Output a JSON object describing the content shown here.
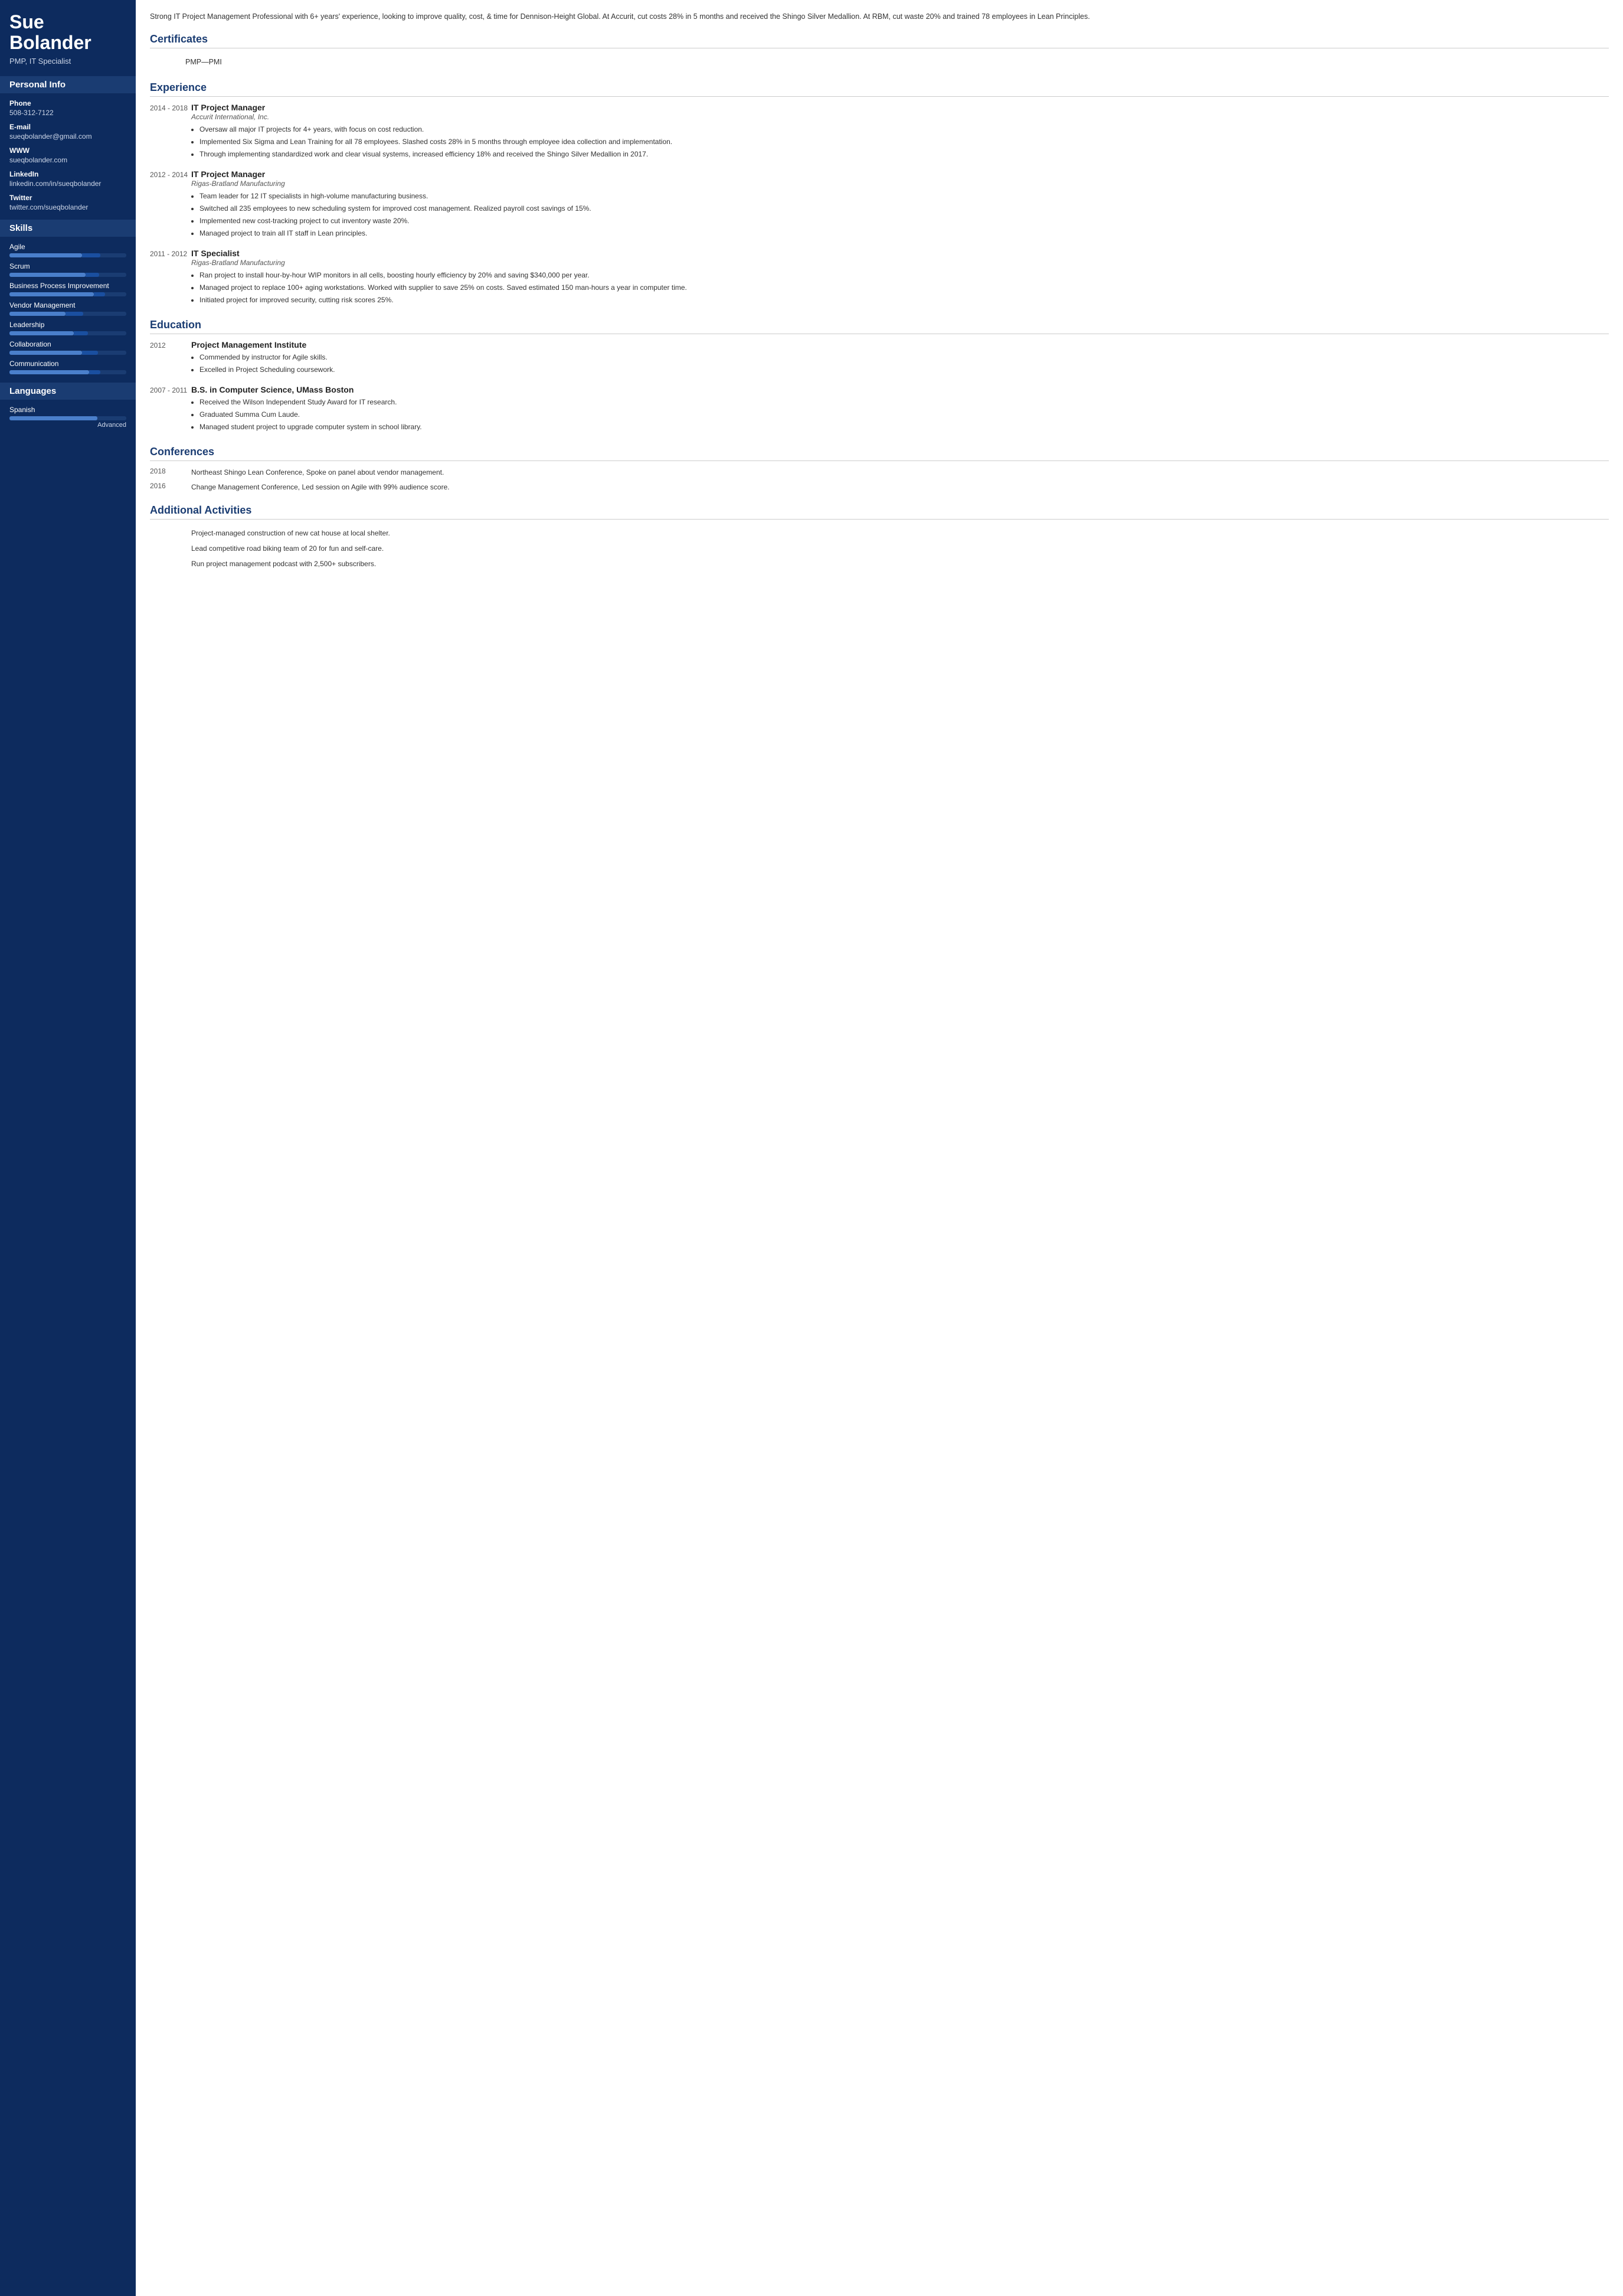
{
  "sidebar": {
    "name": "Sue Bolander",
    "title": "PMP, IT Specialist",
    "personal_info_label": "Personal Info",
    "phone_label": "Phone",
    "phone": "508-312-7122",
    "email_label": "E-mail",
    "email": "sueqbolander@gmail.com",
    "www_label": "WWW",
    "www": "sueqbolander.com",
    "linkedin_label": "LinkedIn",
    "linkedin": "linkedin.com/in/sueqbolander",
    "twitter_label": "Twitter",
    "twitter": "twitter.com/sueqbolander",
    "skills_label": "Skills",
    "skills": [
      {
        "name": "Agile",
        "fill": 62,
        "accent_start": 62,
        "accent_width": 16
      },
      {
        "name": "Scrum",
        "fill": 65,
        "accent_start": 65,
        "accent_width": 12
      },
      {
        "name": "Business Process Improvement",
        "fill": 72,
        "accent_start": 72,
        "accent_width": 10
      },
      {
        "name": "Vendor Management",
        "fill": 48,
        "accent_start": 48,
        "accent_width": 15
      },
      {
        "name": "Leadership",
        "fill": 55,
        "accent_start": 55,
        "accent_width": 12
      },
      {
        "name": "Collaboration",
        "fill": 62,
        "accent_start": 62,
        "accent_width": 14
      },
      {
        "name": "Communication",
        "fill": 68,
        "accent_start": 68,
        "accent_width": 10
      }
    ],
    "languages_label": "Languages",
    "languages": [
      {
        "name": "Spanish",
        "fill": 75,
        "accent_start": 75,
        "accent_width": 0,
        "level": "Advanced"
      }
    ]
  },
  "main": {
    "summary": "Strong IT Project Management Professional with 6+ years' experience, looking to improve quality, cost, & time for Dennison-Height Global. At Accurit, cut costs 28% in 5 months and received the Shingo Silver Medallion. At RBM, cut waste 20% and trained 78 employees in Lean Principles.",
    "certificates_label": "Certificates",
    "certificates": [
      {
        "text": "PMP—PMI"
      }
    ],
    "experience_label": "Experience",
    "experiences": [
      {
        "date": "2014 - 2018",
        "title": "IT Project Manager",
        "company": "Accurit International, Inc.",
        "bullets": [
          "Oversaw all major IT projects for 4+ years, with focus on cost reduction.",
          "Implemented Six Sigma and Lean Training for all 78 employees. Slashed costs 28% in 5 months through employee idea collection and implementation.",
          "Through implementing standardized work and clear visual systems, increased efficiency 18% and received the Shingo Silver Medallion in 2017."
        ]
      },
      {
        "date": "2012 - 2014",
        "title": "IT Project Manager",
        "company": "Rigas-Bratland Manufacturing",
        "bullets": [
          "Team leader for 12 IT specialists in high-volume manufacturing business.",
          "Switched all 235 employees to new scheduling system for improved cost management. Realized payroll cost savings of 15%.",
          "Implemented new cost-tracking project to cut inventory waste 20%.",
          "Managed project to train all IT staff in Lean principles."
        ]
      },
      {
        "date": "2011 - 2012",
        "title": "IT Specialist",
        "company": "Rigas-Bratland Manufacturing",
        "bullets": [
          "Ran project to install hour-by-hour WIP monitors in all cells, boosting hourly efficiency by 20% and saving $340,000 per year.",
          "Managed project to replace 100+ aging workstations. Worked with supplier to save 25% on costs. Saved estimated 150 man-hours a year in computer time.",
          "Initiated project for improved security, cutting risk scores 25%."
        ]
      }
    ],
    "education_label": "Education",
    "educations": [
      {
        "date": "2012",
        "degree": "Project Management Institute",
        "bullets": [
          "Commended by instructor for Agile skills.",
          "Excelled in Project Scheduling coursework."
        ]
      },
      {
        "date": "2007 - 2011",
        "degree": "B.S. in Computer Science, UMass Boston",
        "bullets": [
          "Received the Wilson Independent Study Award for IT research.",
          "Graduated Summa Cum Laude.",
          "Managed student project to upgrade computer system in school library."
        ]
      }
    ],
    "conferences_label": "Conferences",
    "conferences": [
      {
        "year": "2018",
        "text": "Northeast Shingo Lean Conference, Spoke on panel about vendor management."
      },
      {
        "year": "2016",
        "text": "Change Management Conference, Led session on Agile with 99% audience score."
      }
    ],
    "activities_label": "Additional Activities",
    "activities": [
      "Project-managed construction of new cat house at local shelter.",
      "Lead competitive road biking team of 20 for fun and self-care.",
      "Run project management podcast with 2,500+ subscribers."
    ]
  }
}
